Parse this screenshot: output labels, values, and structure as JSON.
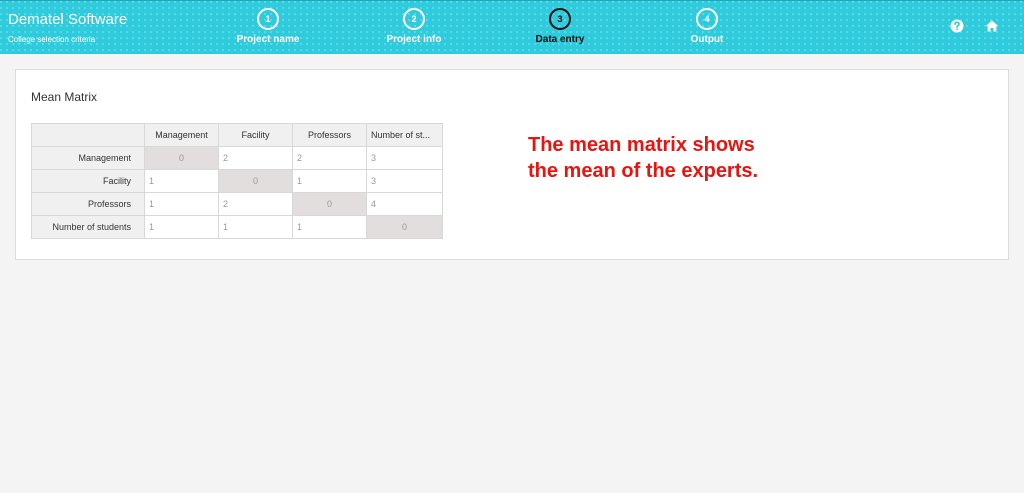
{
  "header": {
    "title": "Dematel Software",
    "subtitle": "College selection criteria",
    "steps": [
      {
        "number": "1",
        "label": "Project name"
      },
      {
        "number": "2",
        "label": "Project info"
      },
      {
        "number": "3",
        "label": "Data entry"
      },
      {
        "number": "4",
        "label": "Output"
      }
    ],
    "active_step": 3,
    "icons": [
      "help-icon",
      "home-icon"
    ]
  },
  "panel": {
    "title": "Mean Matrix",
    "columns": [
      "Management",
      "Facility",
      "Professors",
      "Number of st..."
    ],
    "rows": [
      {
        "label": "Management",
        "cells": [
          "0",
          "2",
          "2",
          "3"
        ]
      },
      {
        "label": "Facility",
        "cells": [
          "1",
          "0",
          "1",
          "3"
        ]
      },
      {
        "label": "Professors",
        "cells": [
          "1",
          "2",
          "0",
          "4"
        ]
      },
      {
        "label": "Number of students",
        "cells": [
          "1",
          "1",
          "1",
          "0"
        ]
      }
    ]
  },
  "annotation": {
    "line1": "The mean matrix shows",
    "line2": "the mean of the experts."
  },
  "colors": {
    "header_bg": "#2ecbdc",
    "annotation": "#e8140f",
    "diagonal_cell": "#e2dedd"
  }
}
